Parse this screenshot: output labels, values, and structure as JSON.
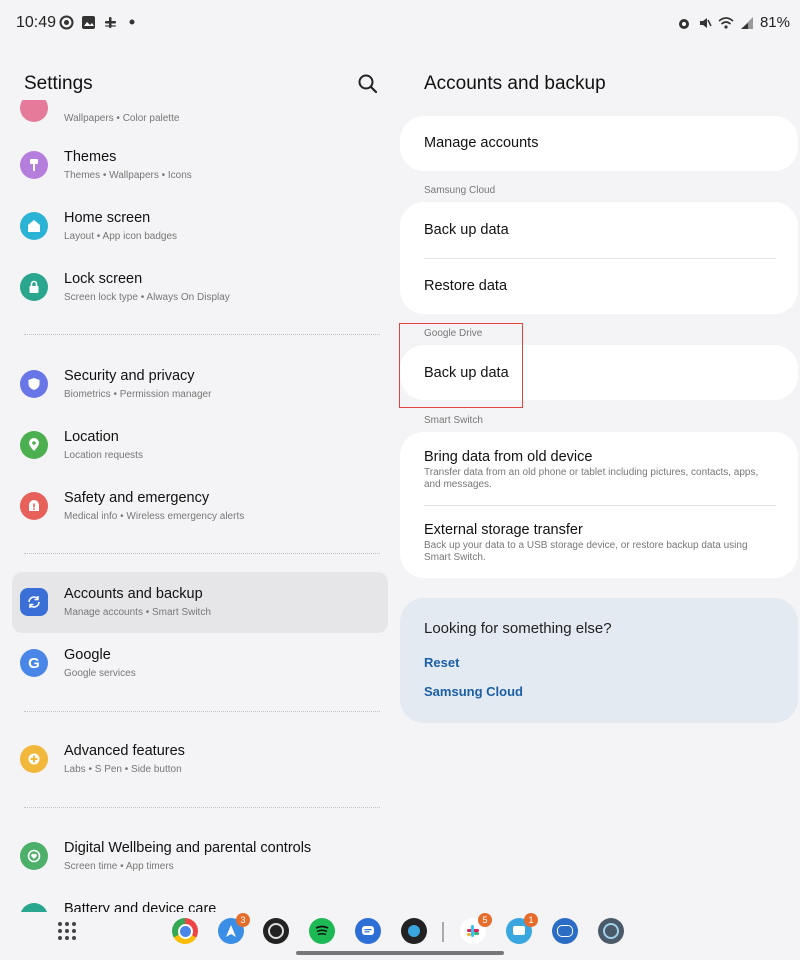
{
  "status": {
    "time": "10:49",
    "battery": "81%"
  },
  "settings": {
    "title": "Settings",
    "partial_top_sub": "Wallpapers • Color palette",
    "items": [
      {
        "label": "Themes",
        "sub": "Themes  •  Wallpapers  •  Icons",
        "color": "#b57edc",
        "icon": "brush-icon"
      },
      {
        "label": "Home screen",
        "sub": "Layout  •  App icon badges",
        "color": "#2bb3d6",
        "icon": "home-icon"
      },
      {
        "label": "Lock screen",
        "sub": "Screen lock type  •  Always On Display",
        "color": "#2aa58e",
        "icon": "lock-icon"
      },
      {
        "label": "Security and privacy",
        "sub": "Biometrics  •  Permission manager",
        "color": "#6876e8",
        "icon": "shield-icon"
      },
      {
        "label": "Location",
        "sub": "Location requests",
        "color": "#4caf50",
        "icon": "location-pin-icon"
      },
      {
        "label": "Safety and emergency",
        "sub": "Medical info  •  Wireless emergency alerts",
        "color": "#e8605a",
        "icon": "alert-icon"
      },
      {
        "label": "Accounts and backup",
        "sub": "Manage accounts  •  Smart Switch",
        "color": "#3a6fd8",
        "icon": "sync-icon"
      },
      {
        "label": "Google",
        "sub": "Google services",
        "color": "#4a86e8",
        "icon": "google-icon"
      },
      {
        "label": "Advanced features",
        "sub": "Labs  •  S Pen  •  Side button",
        "color": "#f2b83b",
        "icon": "plus-gear-icon"
      },
      {
        "label": "Digital Wellbeing and parental controls",
        "sub": "Screen time  •  App timers",
        "color": "#4caf6a",
        "icon": "heart-icon"
      },
      {
        "label": "Battery and device care",
        "sub": "",
        "color": "#2aa58e",
        "icon": "battery-care-icon"
      }
    ]
  },
  "accounts": {
    "title": "Accounts and backup",
    "manage_accounts": "Manage accounts",
    "samsung_cloud": {
      "header": "Samsung Cloud",
      "back_up": "Back up data",
      "restore": "Restore data"
    },
    "google_drive": {
      "header": "Google Drive",
      "back_up": "Back up data"
    },
    "smart_switch": {
      "header": "Smart Switch",
      "bring_label": "Bring data from old device",
      "bring_desc": "Transfer data from an old phone or tablet including pictures, contacts, apps, and messages.",
      "external_label": "External storage transfer",
      "external_desc": "Back up your data to a USB storage device, or restore backup data using Smart Switch."
    },
    "help": {
      "question": "Looking for something else?",
      "link1": "Reset",
      "link2": "Samsung Cloud"
    }
  },
  "dock": {
    "badges": {
      "assistant": "3",
      "slack": "5",
      "messages": "1"
    },
    "apps": [
      "chrome",
      "assistant",
      "camera",
      "spotify",
      "messages",
      "screen-recorder",
      "slack",
      "messages-blue",
      "one-ui",
      "app"
    ]
  }
}
